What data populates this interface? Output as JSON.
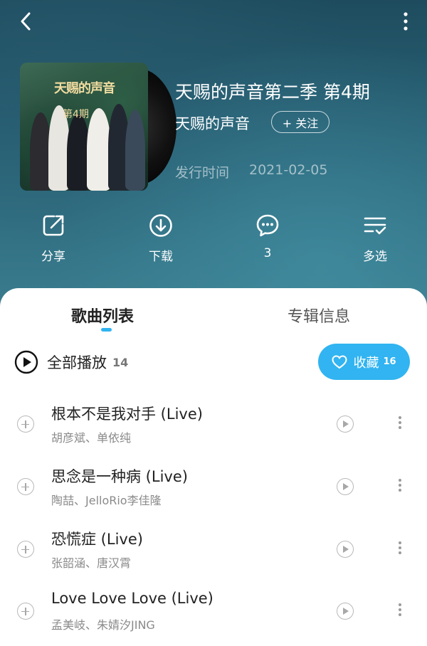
{
  "header": {
    "back_icon": "chevron-left-icon",
    "more_icon": "vertical-dots-icon"
  },
  "album": {
    "cover_logo": "天赐的声音",
    "cover_episode": "第4期",
    "title": "天赐的声音第二季 第4期",
    "artist": "天赐的声音",
    "follow_label": "+ 关注",
    "release_label": "发行时间",
    "release_date": "2021-02-05"
  },
  "actions": [
    {
      "label": "分享",
      "icon": "share-icon"
    },
    {
      "label": "下载",
      "icon": "download-icon"
    },
    {
      "label": "3",
      "icon": "comment-icon"
    },
    {
      "label": "多选",
      "icon": "multi-select-icon"
    }
  ],
  "tabs": {
    "songs": "歌曲列表",
    "info": "专辑信息"
  },
  "play_all": {
    "label": "全部播放",
    "count": "14"
  },
  "favorite": {
    "label": "收藏",
    "count": "16"
  },
  "songs": [
    {
      "title": "根本不是我对手 (Live)",
      "artists": "胡彦斌、单依纯"
    },
    {
      "title": "思念是一种病 (Live)",
      "artists": "陶喆、JelloRio李佳隆"
    },
    {
      "title": "恐慌症 (Live)",
      "artists": "张韶涵、唐汉霄"
    },
    {
      "title": "Love Love Love (Live)",
      "artists": "孟美岐、朱婧汐JING"
    }
  ],
  "colors": {
    "accent": "#31b4f1",
    "hero_top": "#1e4c5e",
    "hero_bottom": "#3a7d8f"
  }
}
